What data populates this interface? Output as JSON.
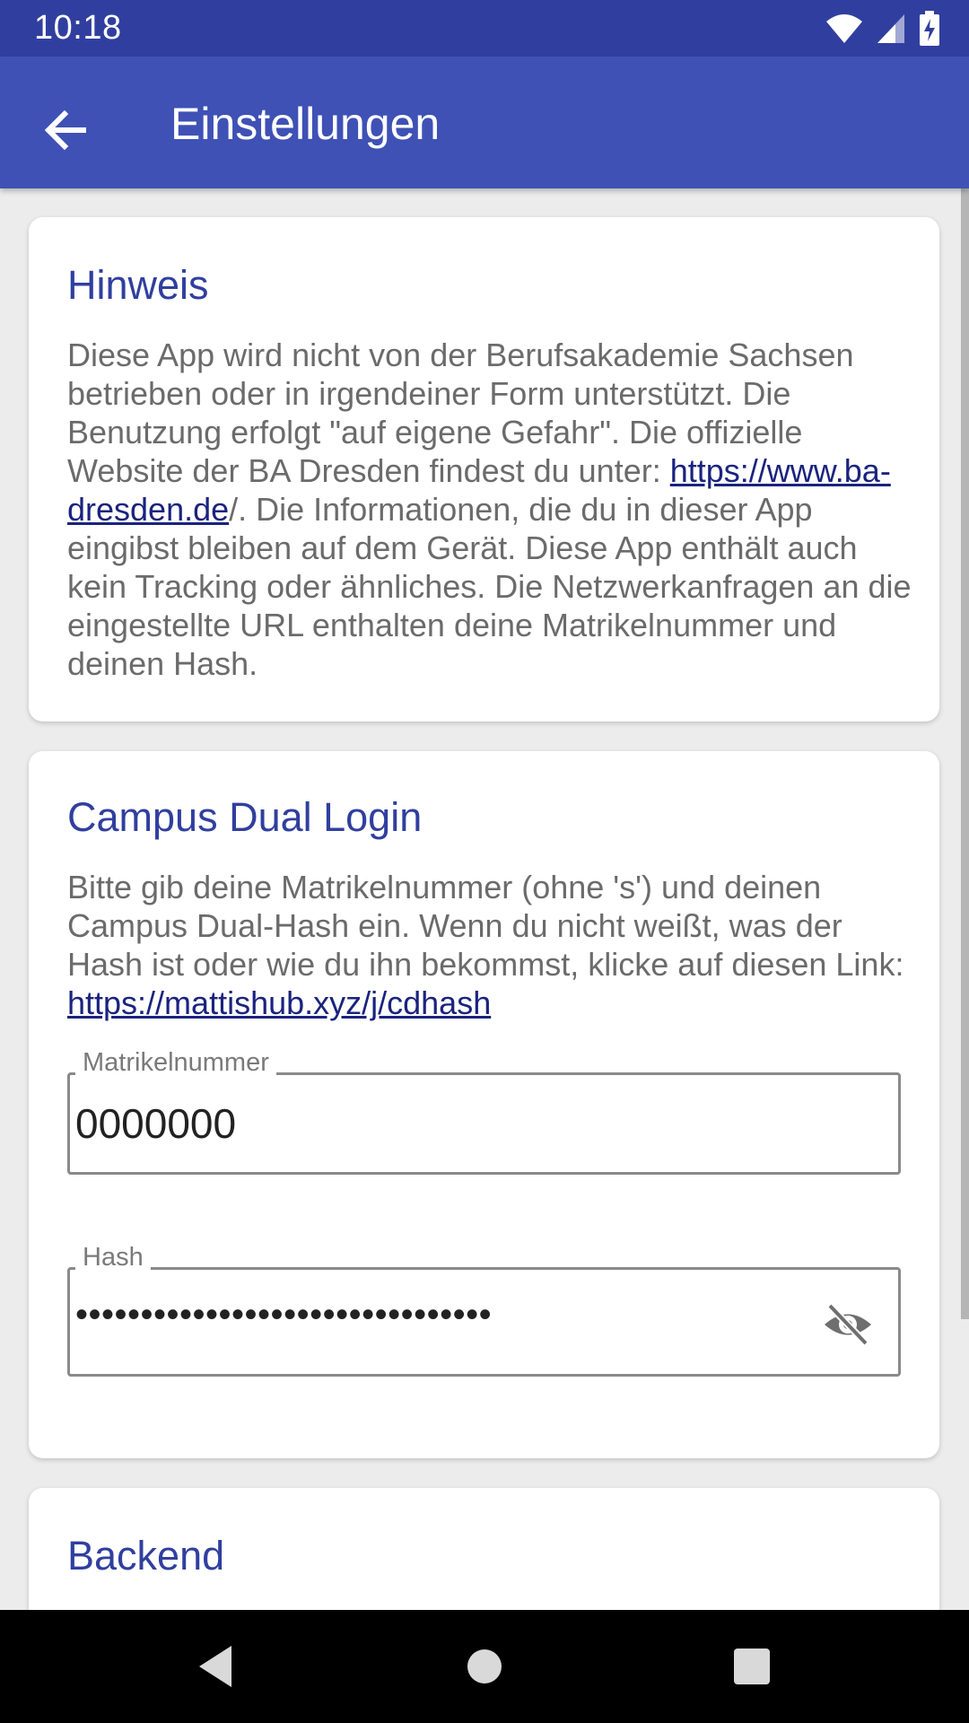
{
  "status_bar": {
    "time": "10:18"
  },
  "app_bar": {
    "title": "Einstellungen"
  },
  "hinweis": {
    "title": "Hinweis",
    "text_part1": "Diese App wird nicht von der Berufsakademie Sachsen betrieben oder in irgendeiner Form unterstützt. Die Benutzung erfolgt \"auf eigene Gefahr\".  Die offizielle Website der BA Dresden findest du unter: ",
    "link": "https://www.ba-dresden.de",
    "text_part2": "/.  Die Informationen, die du in dieser App eingibst bleiben auf dem Gerät. Diese App enthält auch kein Tracking oder ähnliches. Die Netzwerkanfragen an die eingestellte URL enthalten deine Matrikelnummer und deinen Hash."
  },
  "campus_dual": {
    "title": "Campus Dual Login",
    "text_part1": "Bitte gib deine Matrikelnummer (ohne 's') und deinen Campus Dual-Hash ein. Wenn du nicht weißt, was der Hash ist oder wie du ihn bekommst, klicke auf diesen Link: ",
    "link": "https://mattishub.xyz/j/cdhash",
    "matrikel_label": "Matrikelnummer",
    "matrikel_value": "0000000",
    "hash_label": "Hash",
    "hash_masked": "••••••••••••••••••••••••••••••••"
  },
  "backend": {
    "title": "Backend"
  },
  "icons": {
    "back": "arrow-back-icon",
    "wifi": "wifi-icon",
    "signal": "cell-signal-icon",
    "battery": "battery-charging-icon",
    "visibility": "visibility-off-icon",
    "nav_back": "nav-back-icon",
    "nav_home": "nav-home-icon",
    "nav_recents": "nav-recents-icon"
  },
  "colors": {
    "primary": "#3f51b5",
    "primary_dark": "#303f9f",
    "title": "#303f9f",
    "body_text": "#6b6b6b",
    "link": "#1a237e"
  }
}
